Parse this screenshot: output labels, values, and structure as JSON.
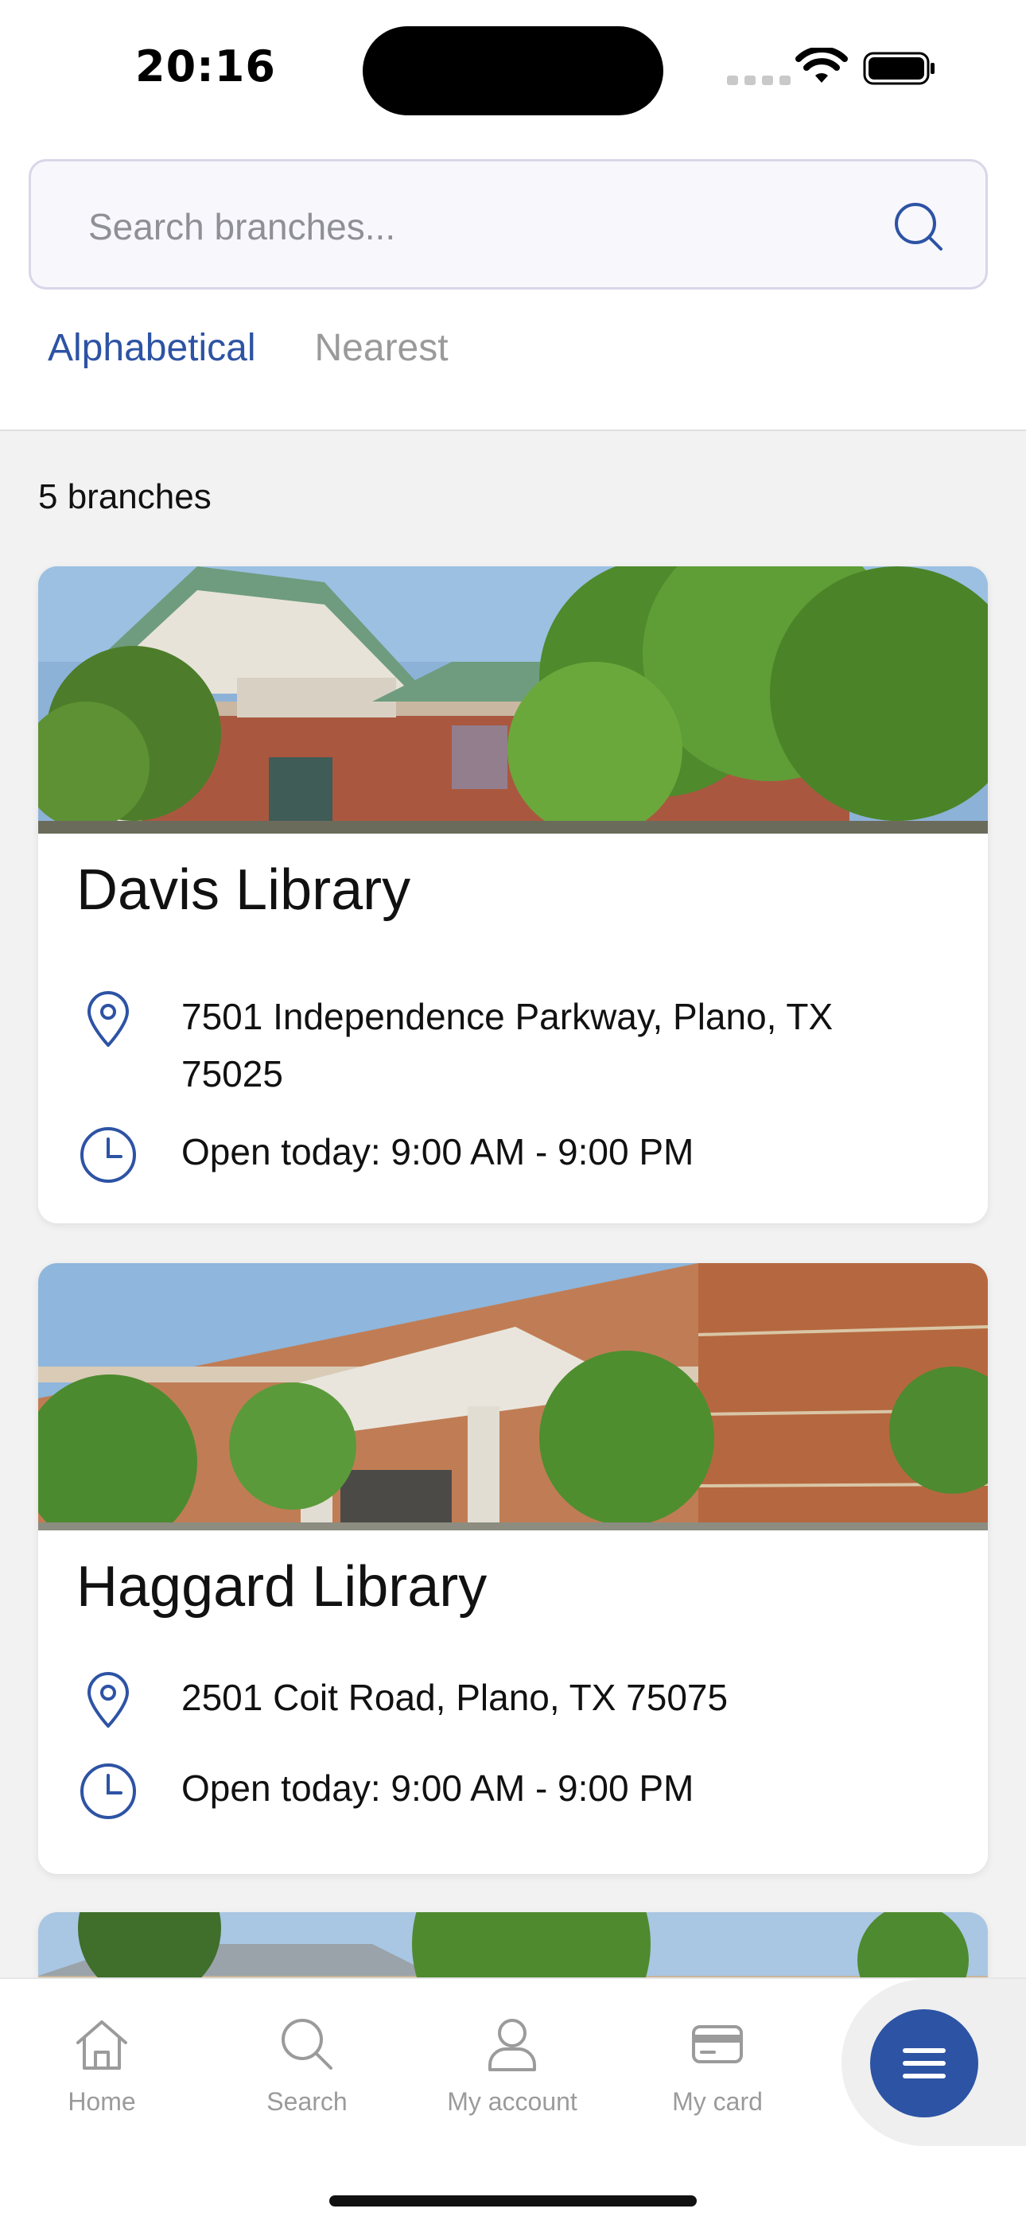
{
  "status_bar": {
    "time": "20:16"
  },
  "search": {
    "placeholder": "Search branches..."
  },
  "tabs": [
    {
      "label": "Alphabetical",
      "active": true
    },
    {
      "label": "Nearest",
      "active": false
    }
  ],
  "branch_count": "5 branches",
  "branches": [
    {
      "name": "Davis Library",
      "address": "7501 Independence Parkway, Plano, TX 75025",
      "hours": "Open today: 9:00 AM - 9:00 PM"
    },
    {
      "name": "Haggard Library",
      "address": "2501 Coit Road, Plano, TX 75075",
      "hours": "Open today: 9:00 AM - 9:00 PM"
    }
  ],
  "bottom_nav": [
    {
      "label": "Home",
      "icon": "home-icon"
    },
    {
      "label": "Search",
      "icon": "search-icon"
    },
    {
      "label": "My account",
      "icon": "person-icon"
    },
    {
      "label": "My card",
      "icon": "card-icon"
    }
  ],
  "colors": {
    "accent": "#2d53a4",
    "inactive": "#9b9b9b",
    "background": "#f2f2f2"
  }
}
